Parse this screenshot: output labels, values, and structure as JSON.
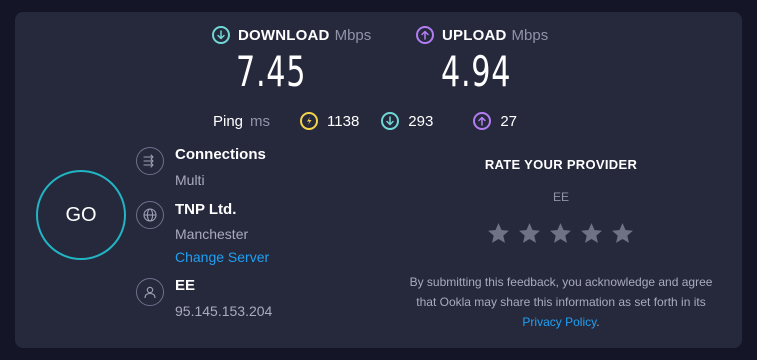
{
  "download": {
    "label": "DOWNLOAD",
    "unit": "Mbps",
    "value": "7.45"
  },
  "upload": {
    "label": "UPLOAD",
    "unit": "Mbps",
    "value": "4.94"
  },
  "ping": {
    "label": "Ping",
    "unit": "ms",
    "idle": "1138",
    "download": "293",
    "upload": "27"
  },
  "go_label": "GO",
  "connections": {
    "title": "Connections",
    "value": "Multi"
  },
  "server": {
    "title": "TNP Ltd.",
    "location": "Manchester",
    "change_label": "Change Server"
  },
  "isp": {
    "title": "EE",
    "ip": "95.145.153.204"
  },
  "rating": {
    "title": "RATE YOUR PROVIDER",
    "provider": "EE",
    "stars_total": 5,
    "stars_selected": 0,
    "disclaimer_text": "By submitting this feedback, you acknowledge and agree that Ookla may share this information as set forth in its ",
    "policy_link": "Privacy Policy",
    "disclaimer_end": "."
  },
  "colors": {
    "background": "#141526",
    "panel": "#26283c",
    "download_accent": "#6fd7d4",
    "upload_accent": "#b27cf2",
    "ping_accent": "#f3d34a",
    "go_ring": "#21b5c4",
    "link": "#1ea1f2",
    "star_empty": "#6f7185"
  }
}
